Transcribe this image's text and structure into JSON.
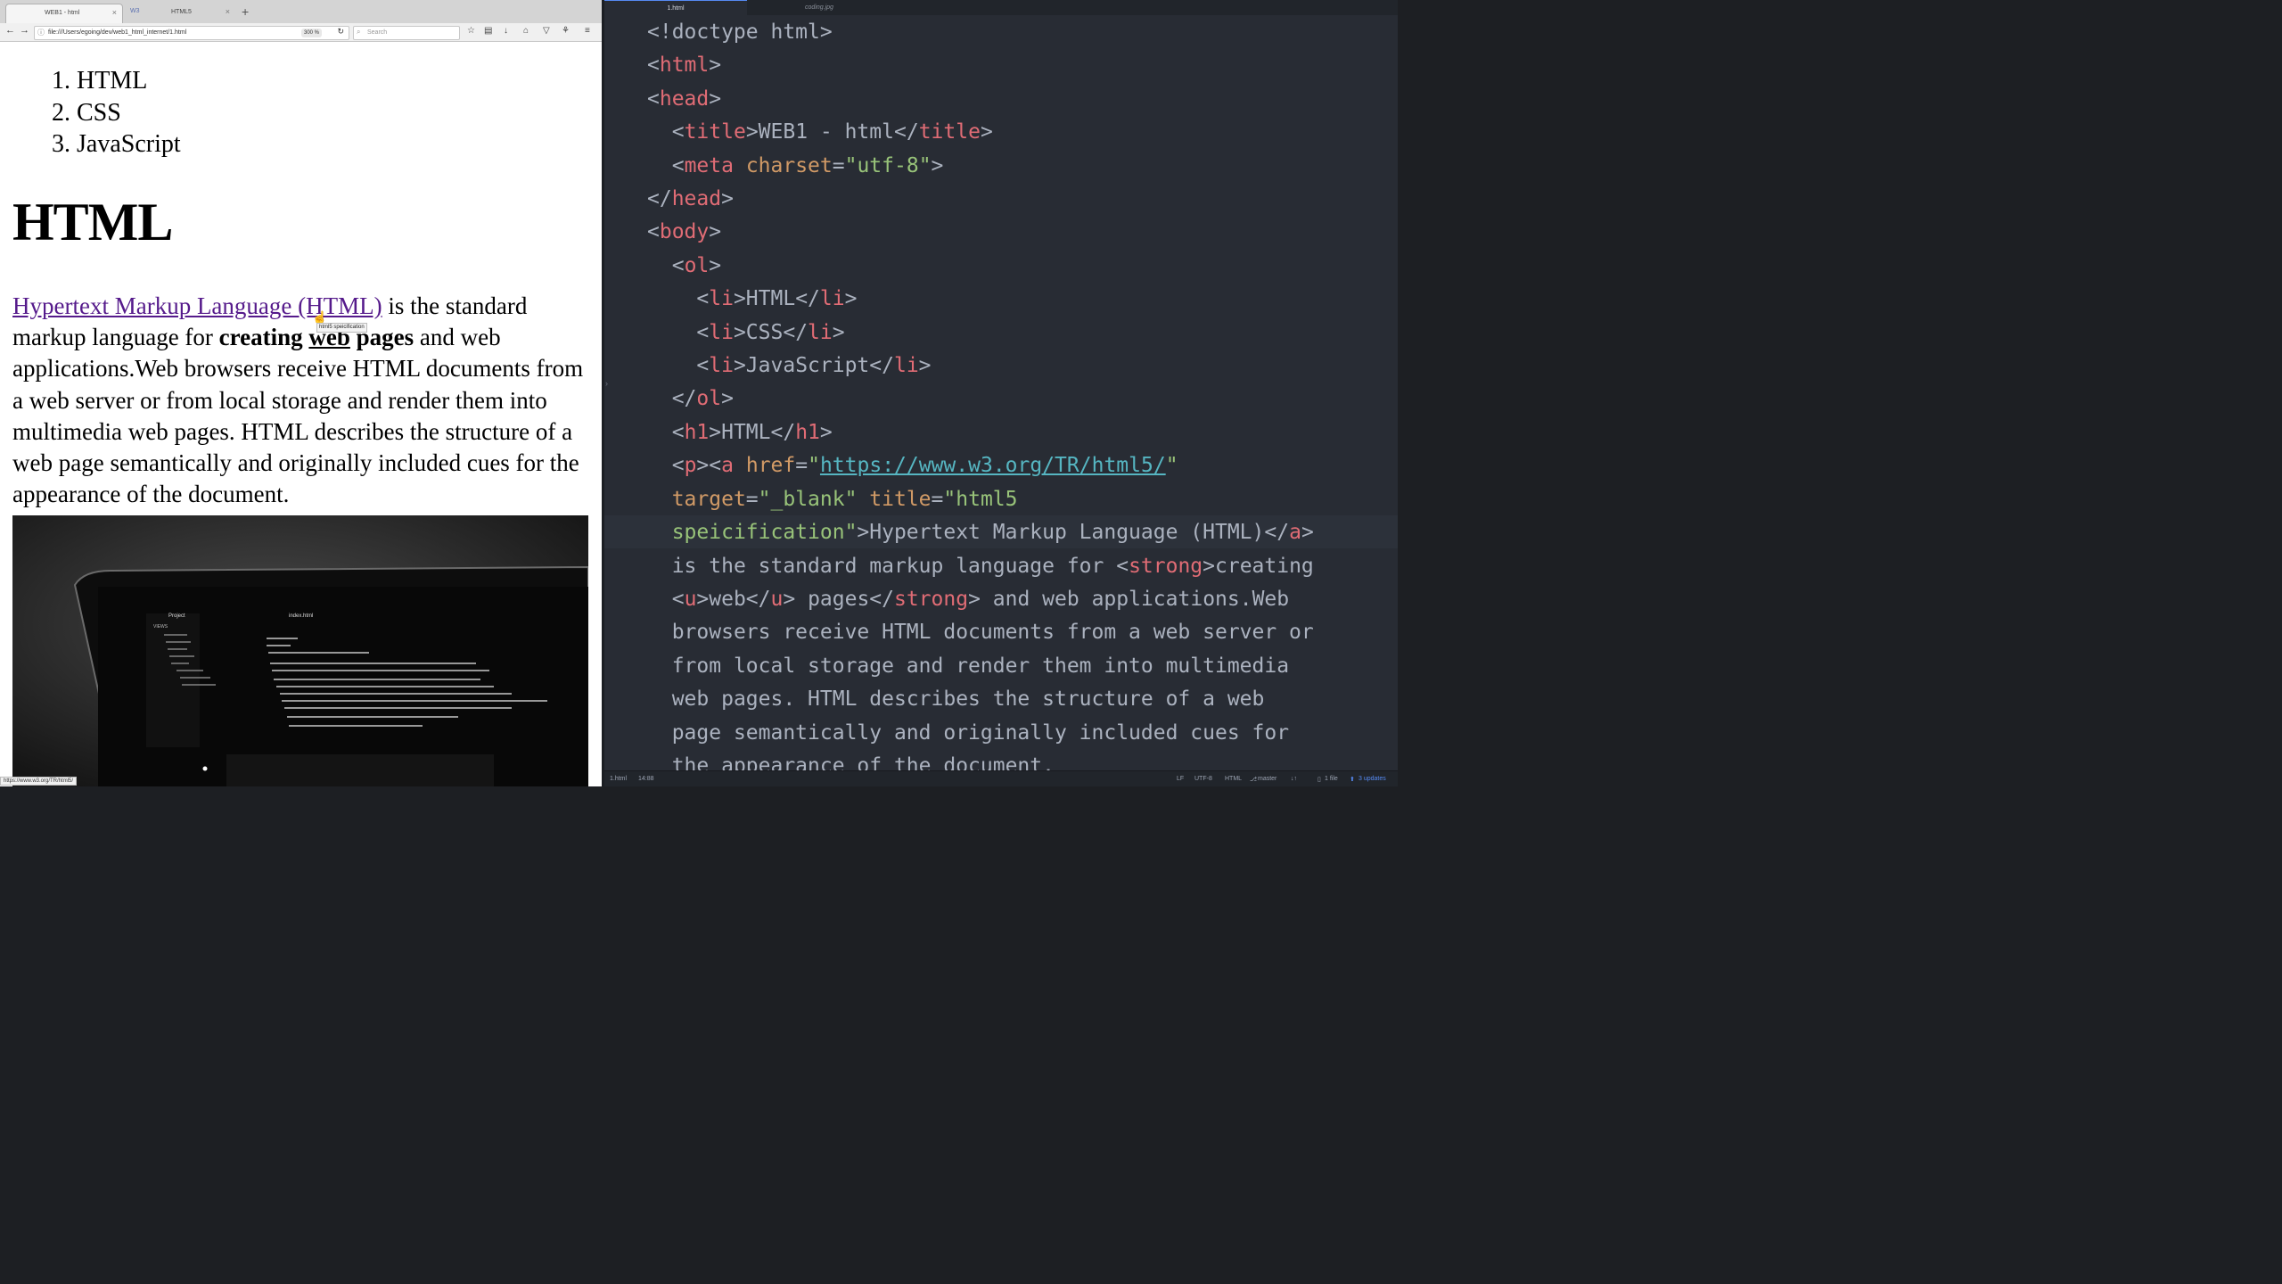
{
  "browser": {
    "tabs": [
      {
        "label": "WEB1 - html",
        "close": "×"
      },
      {
        "label": "HTML5",
        "favicon": "W3",
        "close": "×"
      }
    ],
    "new_tab": "+",
    "url": "file:///Users/egoing/dev/web1_html_internet/1.html",
    "zoom": "300 %",
    "search_placeholder": "Search",
    "status_url": "https://www.w3.org/TR/html5/"
  },
  "page": {
    "list": [
      "1. HTML",
      "2. CSS",
      "3. JavaScript"
    ],
    "heading": "HTML",
    "link_text": "Hypertext Markup Language (HTML)",
    "text_1": " is the standard markup language for ",
    "strong_1": "creating ",
    "underline": "web",
    "strong_2": " pages",
    "text_2": " and web applications.Web browsers receive HTML documents from a web server or from local storage and render them into multimedia web pages. HTML describes the structure of a web page semantically and originally included cues for the appearance of the document.",
    "tooltip": "html5 speicification",
    "image_texts": {
      "project": "Project",
      "file": "index.html",
      "views": "VIEWS"
    }
  },
  "editor": {
    "tabs": [
      "1.html",
      "coding.jpg"
    ],
    "status": {
      "file": "1.html",
      "position": "14:88",
      "line_ending": "LF",
      "encoding": "UTF-8",
      "grammar": "HTML",
      "branch": "master",
      "files": "1 file",
      "updates": "3 updates"
    }
  },
  "colors": {
    "editor_bg": "#282c34",
    "tag": "#e06c75",
    "attribute": "#d19a66",
    "string": "#98c379",
    "link": "#56b6c2",
    "visited_link": "#551a8b"
  }
}
